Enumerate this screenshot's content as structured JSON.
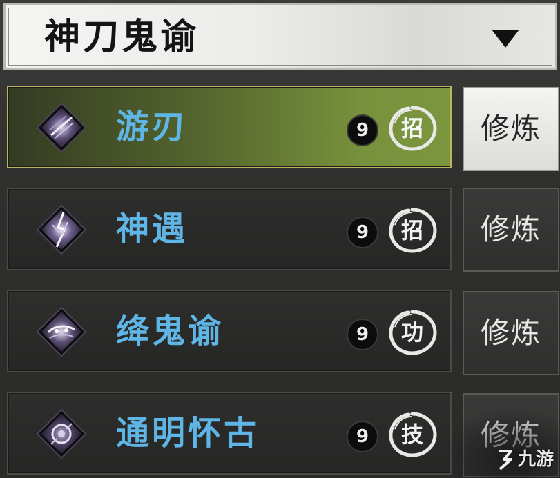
{
  "header": {
    "title": "神刀鬼谕",
    "arrow_icon": "triangle-down-icon"
  },
  "skills": [
    {
      "name": "游刃",
      "level": "9",
      "type": "招",
      "action": "修炼",
      "selected": true,
      "icon": "slash-skill-icon"
    },
    {
      "name": "神遇",
      "level": "9",
      "type": "招",
      "action": "修炼",
      "selected": false,
      "icon": "lightning-skill-icon"
    },
    {
      "name": "绛鬼谕",
      "level": "9",
      "type": "功",
      "action": "修炼",
      "selected": false,
      "icon": "mask-skill-icon"
    },
    {
      "name": "通明怀古",
      "level": "9",
      "type": "技",
      "action": "修炼",
      "selected": false,
      "icon": "orb-skill-icon"
    }
  ],
  "watermark": {
    "text": "九游",
    "icon": "jiuyou-logo-icon"
  },
  "colors": {
    "skill_name": "#5fb6e6",
    "selected_row": "#78913c",
    "selected_border": "#bdb45e",
    "background": "#2f2f2e"
  }
}
